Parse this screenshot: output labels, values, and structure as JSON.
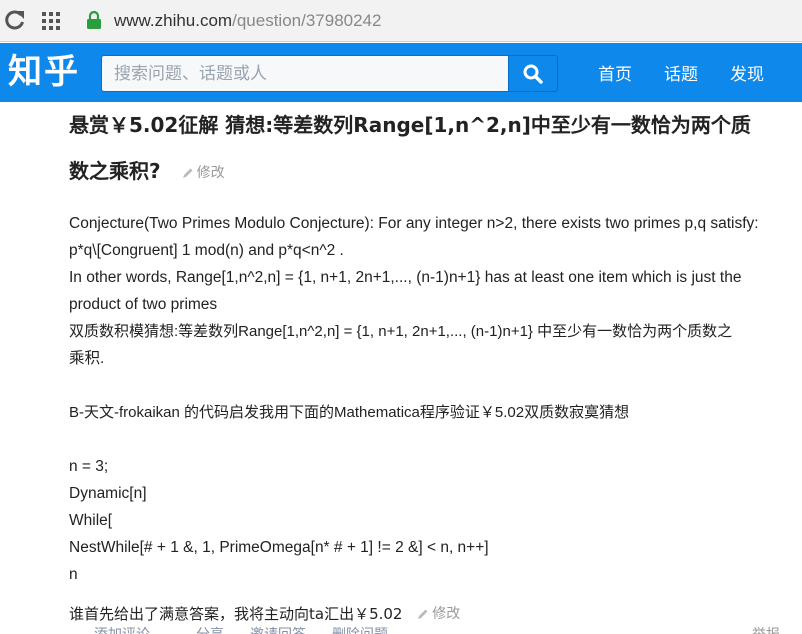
{
  "browser": {
    "url_host": "www.zhihu.com",
    "url_path": "/question/37980242"
  },
  "nav": {
    "logo": "知乎",
    "search_placeholder": "搜索问题、话题或人",
    "links": [
      "首页",
      "话题",
      "发现"
    ],
    "brand_color": "#0f88eb"
  },
  "question": {
    "title_part1": "悬赏￥5.02征解 猜想:等差数列Range[1,n^2,n]中至少有一数恰为两个质",
    "title_part2": "数之乘积?",
    "edit_label": "修改",
    "detail_lines": [
      "Conjecture(Two Primes Modulo Conjecture): For any integer n>2, there exists two primes p,q satisfy:",
      "p*q\\[Congruent] 1 mod(n) and p*q<n^2 .",
      "In other words, Range[1,n^2,n] = {1, n+1, 2n+1,..., (n-1)n+1} has at least one item which is just the",
      "product of two primes",
      "双质数积模猜想:等差数列Range[1,n^2,n] = {1, n+1, 2n+1,..., (n-1)n+1} 中至少有一数恰为两个质数之",
      "乘积.",
      "",
      "B-天文-frokaikan 的代码启发我用下面的Mathematica程序验证￥5.02双质数寂寞猜想",
      "",
      "n = 3;",
      "Dynamic[n]",
      "While[",
      "NestWhile[# + 1 &, 1, PrimeOmega[n* # + 1] != 2 &] < n, n++]",
      "n"
    ],
    "reward_text": "谁首先给出了满意答案，我将主动向ta汇出￥5.02",
    "reward_edit_label": "修改"
  },
  "actions": {
    "items": [
      "添加评论",
      "分享",
      "邀请回答",
      "删除问题"
    ],
    "report": "举报"
  }
}
